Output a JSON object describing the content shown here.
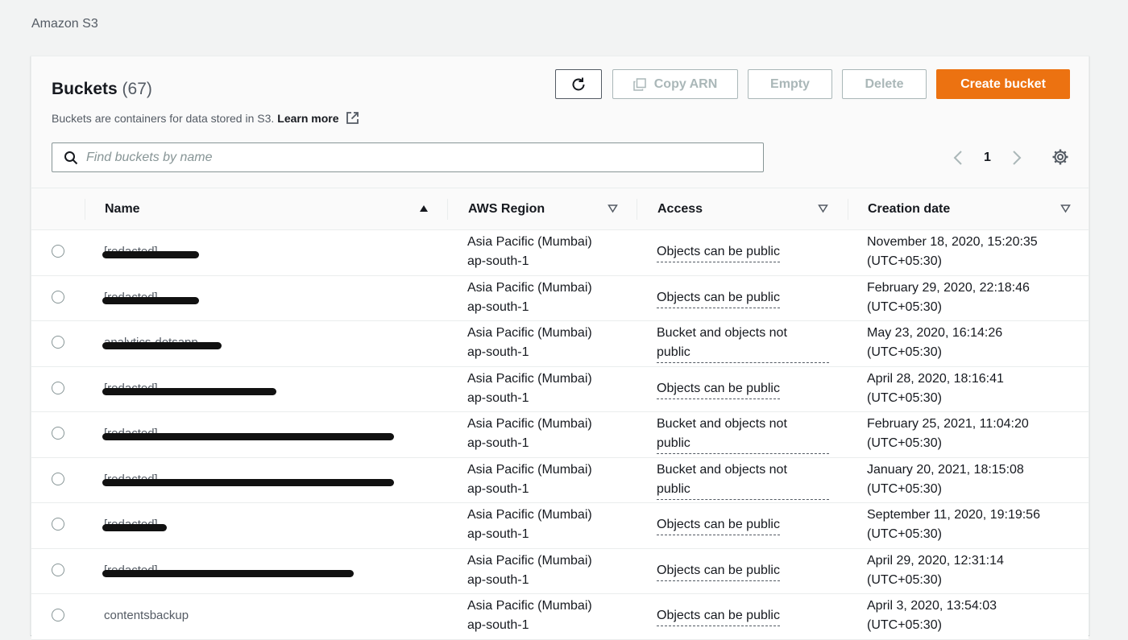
{
  "breadcrumb": "Amazon S3",
  "header": {
    "title": "Buckets",
    "count": "(67)",
    "description": "Buckets are containers for data stored in S3.",
    "learn_more": "Learn more"
  },
  "toolbar": {
    "copy_arn": "Copy ARN",
    "empty": "Empty",
    "delete": "Delete",
    "create": "Create bucket"
  },
  "search": {
    "placeholder": "Find buckets by name"
  },
  "pagination": {
    "page": "1"
  },
  "columns": {
    "name": "Name",
    "region": "AWS Region",
    "access": "Access",
    "created": "Creation date"
  },
  "rows": [
    {
      "name": "[redacted]",
      "region1": "Asia Pacific (Mumbai)",
      "region2": "ap-south-1",
      "access": "Objects can be public",
      "date1": "November 18, 2020, 15:20:35",
      "date2": "(UTC+05:30)"
    },
    {
      "name": "[redacted]",
      "region1": "Asia Pacific (Mumbai)",
      "region2": "ap-south-1",
      "access": "Objects can be public",
      "date1": "February 29, 2020, 22:18:46",
      "date2": "(UTC+05:30)"
    },
    {
      "name": "analytics-dotsapp",
      "region1": "Asia Pacific (Mumbai)",
      "region2": "ap-south-1",
      "access1": "Bucket and objects not",
      "access2": "public",
      "date1": "May 23, 2020, 16:14:26",
      "date2": "(UTC+05:30)"
    },
    {
      "name": "[redacted]",
      "region1": "Asia Pacific (Mumbai)",
      "region2": "ap-south-1",
      "access": "Objects can be public",
      "date1": "April 28, 2020, 18:16:41",
      "date2": "(UTC+05:30)"
    },
    {
      "name": "[redacted]",
      "region1": "Asia Pacific (Mumbai)",
      "region2": "ap-south-1",
      "access1": "Bucket and objects not",
      "access2": "public",
      "date1": "February 25, 2021, 11:04:20",
      "date2": "(UTC+05:30)"
    },
    {
      "name": "[redacted]",
      "region1": "Asia Pacific (Mumbai)",
      "region2": "ap-south-1",
      "access1": "Bucket and objects not",
      "access2": "public",
      "date1": "January 20, 2021, 18:15:08",
      "date2": "(UTC+05:30)"
    },
    {
      "name": "[redacted]",
      "region1": "Asia Pacific (Mumbai)",
      "region2": "ap-south-1",
      "access": "Objects can be public",
      "date1": "September 11, 2020, 19:19:56",
      "date2": "(UTC+05:30)"
    },
    {
      "name": "[redacted]",
      "region1": "Asia Pacific (Mumbai)",
      "region2": "ap-south-1",
      "access": "Objects can be public",
      "date1": "April 29, 2020, 12:31:14",
      "date2": "(UTC+05:30)"
    },
    {
      "name": "contentsbackup",
      "region1": "Asia Pacific (Mumbai)",
      "region2": "ap-south-1",
      "access": "Objects can be public",
      "date1": "April 3, 2020, 13:54:03",
      "date2": "(UTC+05:30)"
    }
  ],
  "colors": {
    "primary": "#ec7211",
    "text": "#16191f",
    "muted": "#545b64",
    "border": "#eaeded"
  },
  "icons": [
    "refresh-icon",
    "copy-icon",
    "external-link-icon",
    "search-icon",
    "chevron-left-icon",
    "chevron-right-icon",
    "gear-icon",
    "sort-asc-icon",
    "sort-desc-icon"
  ]
}
